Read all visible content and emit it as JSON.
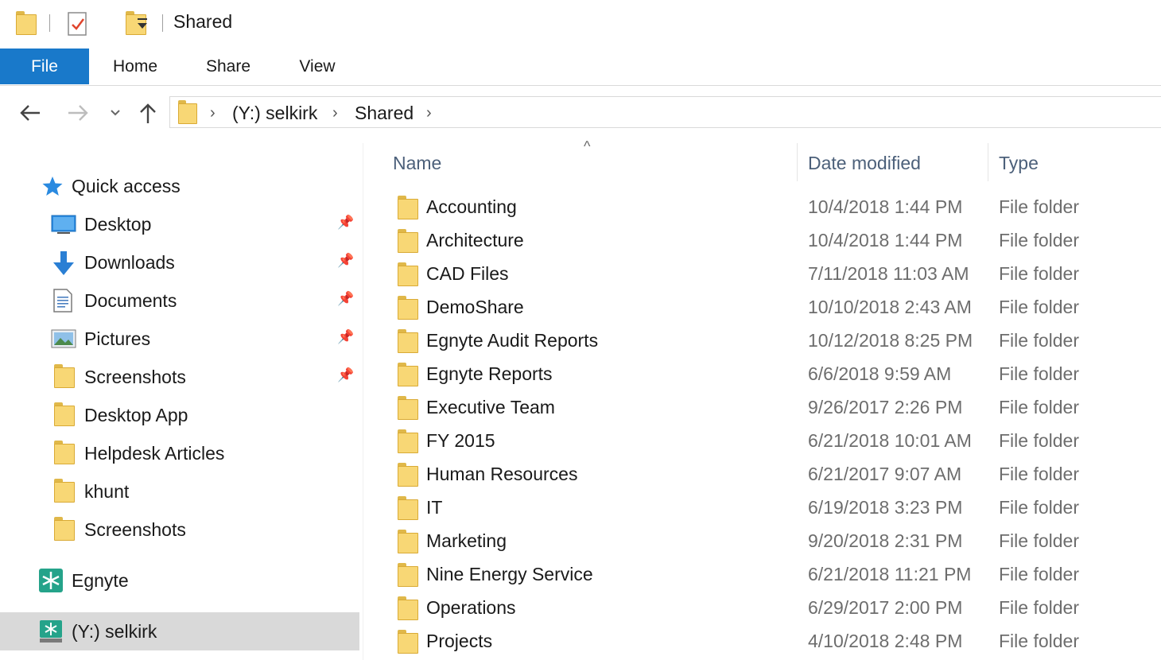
{
  "window": {
    "title": "Shared"
  },
  "ribbon": {
    "tabs": [
      "File",
      "Home",
      "Share",
      "View"
    ]
  },
  "address_bar": {
    "crumbs": [
      "(Y:) selkirk",
      "Shared"
    ]
  },
  "sidebar": {
    "quick_access_label": "Quick access",
    "items": [
      {
        "label": "Desktop",
        "icon": "desktop-icon",
        "pinned": true
      },
      {
        "label": "Downloads",
        "icon": "download-arrow-icon",
        "pinned": true
      },
      {
        "label": "Documents",
        "icon": "document-icon",
        "pinned": true
      },
      {
        "label": "Pictures",
        "icon": "pictures-icon",
        "pinned": true
      },
      {
        "label": "Screenshots",
        "icon": "folder-icon",
        "pinned": true
      },
      {
        "label": "Desktop App",
        "icon": "folder-icon",
        "pinned": false
      },
      {
        "label": "Helpdesk Articles",
        "icon": "folder-icon",
        "pinned": false
      },
      {
        "label": "khunt",
        "icon": "folder-icon",
        "pinned": false
      },
      {
        "label": "Screenshots",
        "icon": "folder-icon",
        "pinned": false
      }
    ],
    "egnyte_label": "Egnyte",
    "drive_label": "(Y:) selkirk"
  },
  "columns": {
    "name": "Name",
    "date": "Date modified",
    "type": "Type"
  },
  "files": [
    {
      "name": "Accounting",
      "date": "10/4/2018 1:44 PM",
      "type": "File folder"
    },
    {
      "name": "Architecture",
      "date": "10/4/2018 1:44 PM",
      "type": "File folder"
    },
    {
      "name": "CAD Files",
      "date": "7/11/2018 11:03 AM",
      "type": "File folder"
    },
    {
      "name": "DemoShare",
      "date": "10/10/2018 2:43 AM",
      "type": "File folder"
    },
    {
      "name": "Egnyte Audit Reports",
      "date": "10/12/2018 8:25 PM",
      "type": "File folder"
    },
    {
      "name": "Egnyte Reports",
      "date": "6/6/2018 9:59 AM",
      "type": "File folder"
    },
    {
      "name": "Executive Team",
      "date": "9/26/2017 2:26 PM",
      "type": "File folder"
    },
    {
      "name": "FY 2015",
      "date": "6/21/2018 10:01 AM",
      "type": "File folder"
    },
    {
      "name": "Human Resources",
      "date": "6/21/2017 9:07 AM",
      "type": "File folder"
    },
    {
      "name": "IT",
      "date": "6/19/2018 3:23 PM",
      "type": "File folder"
    },
    {
      "name": "Marketing",
      "date": "9/20/2018 2:31 PM",
      "type": "File folder"
    },
    {
      "name": "Nine Energy Service",
      "date": "6/21/2018 11:21 PM",
      "type": "File folder"
    },
    {
      "name": "Operations",
      "date": "6/29/2017 2:00 PM",
      "type": "File folder"
    },
    {
      "name": "Projects",
      "date": "4/10/2018 2:48 PM",
      "type": "File folder"
    }
  ],
  "colors": {
    "accent": "#1979ca",
    "folder": "#f8d775",
    "selected": "#d9d9d9"
  }
}
